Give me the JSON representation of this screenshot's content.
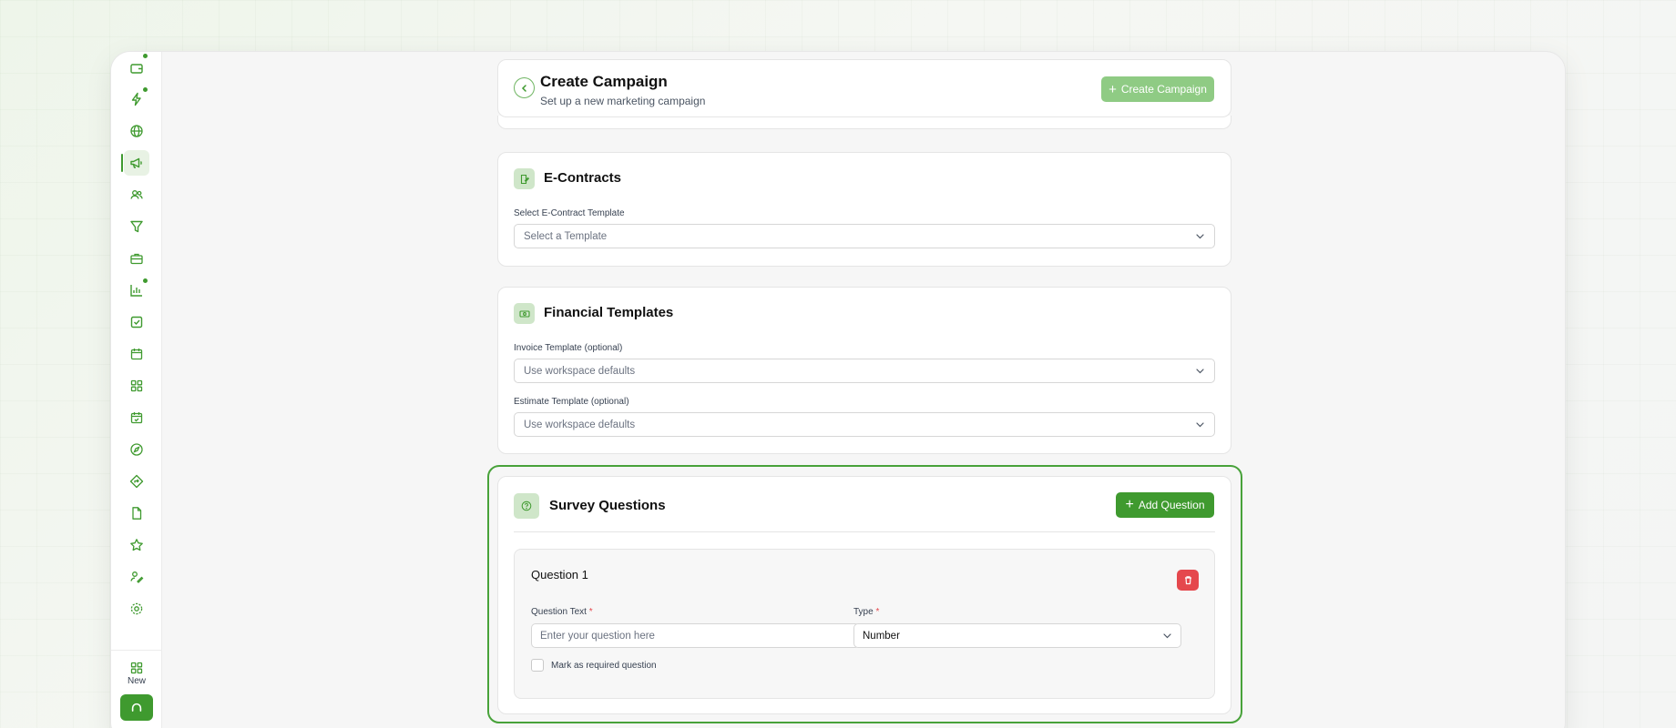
{
  "header": {
    "title": "Create Campaign",
    "subtitle": "Set up a new marketing campaign",
    "create_button": "Create Campaign"
  },
  "econtracts": {
    "title": "E-Contracts",
    "template_label": "Select E-Contract Template",
    "template_placeholder": "Select a Template"
  },
  "financial": {
    "title": "Financial Templates",
    "invoice_label": "Invoice Template (optional)",
    "invoice_value": "Use workspace defaults",
    "estimate_label": "Estimate Template (optional)",
    "estimate_value": "Use workspace defaults"
  },
  "survey": {
    "title": "Survey Questions",
    "add_button": "Add Question",
    "question": {
      "title": "Question 1",
      "text_label": "Question Text",
      "text_placeholder": "Enter your question here",
      "type_label": "Type",
      "type_value": "Number",
      "required_star": "*",
      "required_checkbox_label": "Mark as required question",
      "required_checked": false
    }
  },
  "sidebar": {
    "items": [
      {
        "icon": "wallet-icon"
      },
      {
        "icon": "lightning-icon",
        "badge": true
      },
      {
        "icon": "globe-icon"
      },
      {
        "icon": "megaphone-icon",
        "active": true
      },
      {
        "icon": "users-icon"
      },
      {
        "icon": "filter-icon"
      },
      {
        "icon": "briefcase-icon"
      },
      {
        "icon": "bar-chart-icon",
        "badge": true
      },
      {
        "icon": "checkbox-icon"
      },
      {
        "icon": "calendar-icon"
      },
      {
        "icon": "grid-icon"
      },
      {
        "icon": "calendar-check-icon"
      },
      {
        "icon": "compass-icon"
      },
      {
        "icon": "signpost-icon"
      },
      {
        "icon": "document-icon"
      },
      {
        "icon": "star-icon"
      },
      {
        "icon": "user-signature-icon"
      },
      {
        "icon": "settings-icon"
      }
    ],
    "new_label": "New"
  },
  "colors": {
    "accent": "#3f9a2f",
    "accent_light": "#8fcb84",
    "danger": "#e5484d",
    "highlight_border": "#48a23a"
  }
}
